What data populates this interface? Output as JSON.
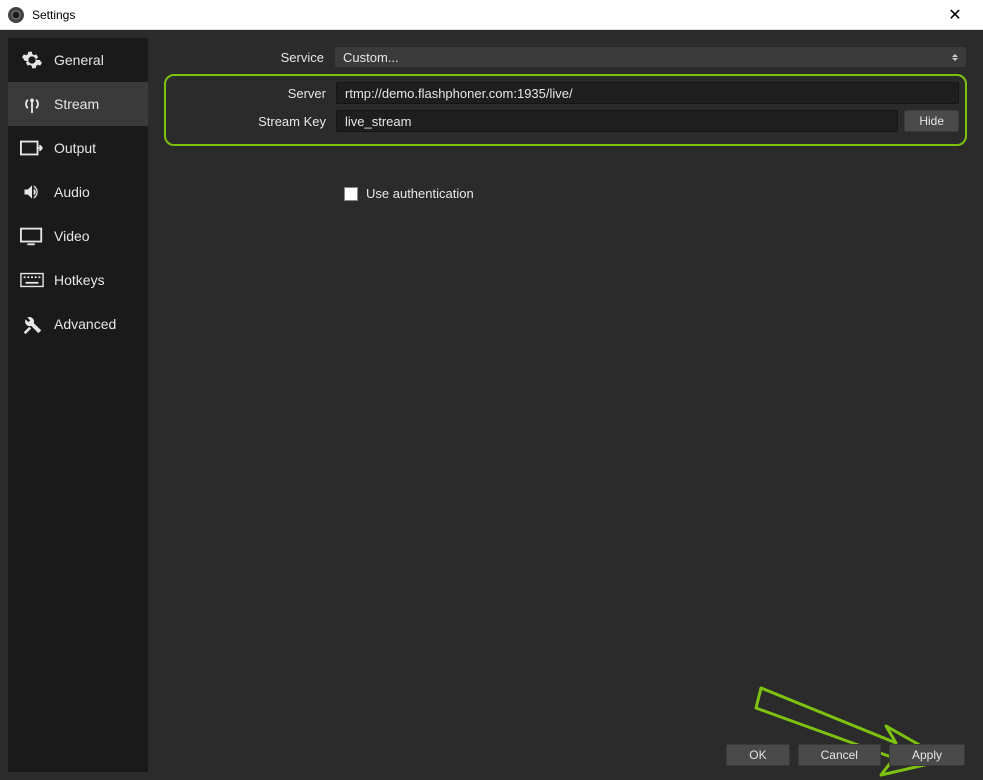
{
  "window": {
    "title": "Settings"
  },
  "sidebar": {
    "items": [
      {
        "label": "General"
      },
      {
        "label": "Stream"
      },
      {
        "label": "Output"
      },
      {
        "label": "Audio"
      },
      {
        "label": "Video"
      },
      {
        "label": "Hotkeys"
      },
      {
        "label": "Advanced"
      }
    ],
    "selected_index": 1
  },
  "form": {
    "service_label": "Service",
    "service_value": "Custom...",
    "server_label": "Server",
    "server_value": "rtmp://demo.flashphoner.com:1935/live/",
    "streamkey_label": "Stream Key",
    "streamkey_value": "live_stream",
    "hide_button": "Hide",
    "auth_label": "Use authentication",
    "auth_checked": false
  },
  "footer": {
    "ok": "OK",
    "cancel": "Cancel",
    "apply": "Apply"
  },
  "highlight_color": "#7cc20f"
}
